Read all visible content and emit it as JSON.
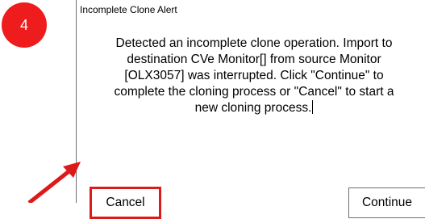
{
  "annotation": {
    "step_number": "4",
    "highlight_color": "#dd1a1a",
    "pointer": "red-arrow pointing to Cancel button"
  },
  "dialog": {
    "title": "Incomplete Clone Alert",
    "message_lines": [
      "Detected an incomplete clone operation. Import to",
      "destination CVe Monitor[] from source Monitor",
      "[OLX3057] was interrupted. Click \"Continue\" to",
      "complete the cloning process or \"Cancel\" to start a",
      "new cloning process."
    ],
    "buttons": {
      "cancel_label": "Cancel",
      "continue_label": "Continue"
    }
  }
}
